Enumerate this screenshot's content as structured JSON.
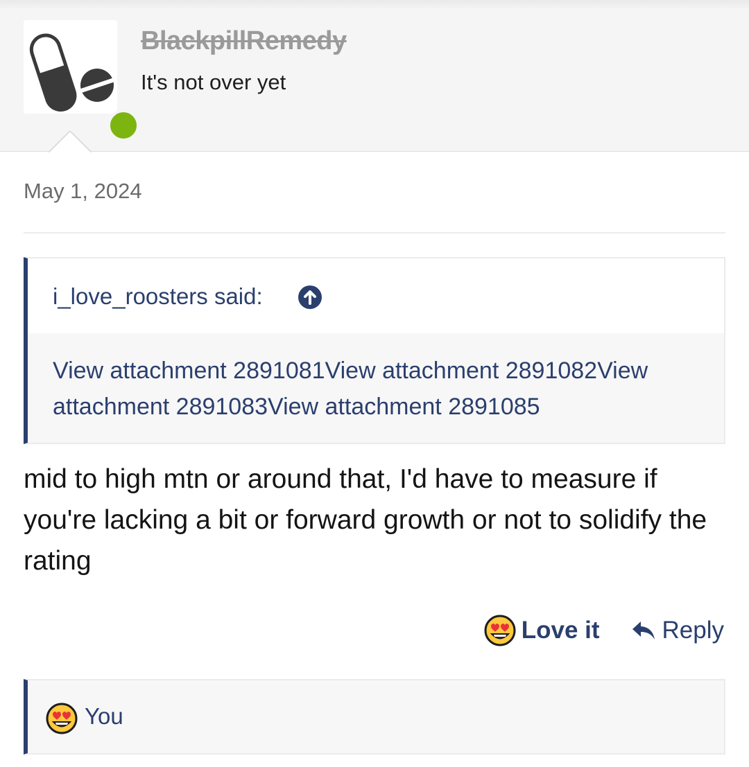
{
  "header": {
    "username": "BlackpillRemedy",
    "user_title": "It's not over yet",
    "avatar_icon": "pill-icon",
    "online_status_color": "#7cb50f"
  },
  "post": {
    "date": "May 1, 2024",
    "quote": {
      "author_label": "i_love_roosters said:",
      "jump_icon": "arrow-up-circle-icon",
      "body": "View attachment 2891081View attachment 2891082View attachment 2891083View attachment 2891085"
    },
    "text": "mid to high mtn or around that, I'd have to measure if you're lacking a bit or forward growth or not to solidify the rating"
  },
  "actions": {
    "love_label": "Love it",
    "love_icon": "heart-eyes-emoji-icon",
    "reply_label": "Reply",
    "reply_icon": "reply-arrow-icon"
  },
  "reactions": {
    "icon": "heart-eyes-emoji-icon",
    "users": "You"
  },
  "colors": {
    "accent": "#2b3f6e",
    "header_bg": "#f5f5f5",
    "quote_bg": "#f7f7f7"
  }
}
